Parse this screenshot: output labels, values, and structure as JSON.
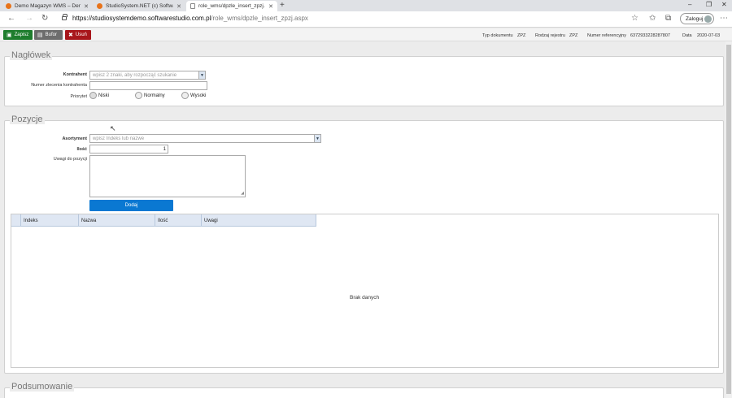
{
  "browser": {
    "tabs": [
      {
        "title": "Demo Magazyn WMS – Demo"
      },
      {
        "title": "StudioSystem.NET (c) Software"
      },
      {
        "title": "role_wms/dpzle_insert_zpzj.aspx"
      }
    ],
    "url_host": "https://studiosystemdemo.softwarestudio.com.pl",
    "url_path": "/role_wms/dpzle_insert_zpzj.aspx",
    "login_label": "Zaloguj"
  },
  "toolbar": {
    "save_label": "Zapisz",
    "buffer_label": "Bufor",
    "delete_label": "Usuń",
    "doc_type_label": "Typ dokumentu",
    "doc_type_value": "ZPZ",
    "register_label": "Rodzaj rejestru",
    "register_value": "ZPZ",
    "ref_label": "Numer referencyjny",
    "ref_value": "6372933228287807",
    "date_label": "Data",
    "date_value": "2020-07-03",
    "colors": {
      "save": "#1e7d2d",
      "buffer": "#6d6d6d",
      "delete": "#a8161b"
    }
  },
  "header": {
    "legend": "Nagłówek",
    "contractor_label": "Kontrahent",
    "contractor_placeholder": "wpisz 2 znaki, aby rozpocząć szukanie",
    "order_no_label": "Numer zlecenia kontrahenta",
    "priority_label": "Priorytet",
    "priority_options": [
      "Niski",
      "Normalny",
      "Wysoki"
    ]
  },
  "positions": {
    "legend": "Pozycje",
    "assortment_label": "Asortyment",
    "assortment_placeholder": "wpisz Indeks lub  nazwe",
    "quantity_label": "Ilość",
    "quantity_value": "1",
    "notes_label": "Uwagi do pozycji",
    "add_label": "Dodaj",
    "columns": [
      "Indeks",
      "Nazwa",
      "Ilość",
      "Uwagi"
    ],
    "empty_text": "Brak danych"
  },
  "summary": {
    "legend": "Podsumowanie"
  }
}
